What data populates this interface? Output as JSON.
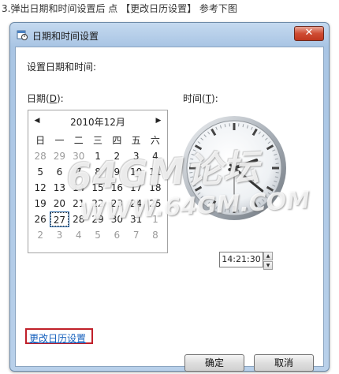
{
  "caption": "3.弹出日期和时间设置后 点 【更改日历设置】 参考下图",
  "window": {
    "title": "日期和时间设置",
    "close_label": "✕"
  },
  "heading": "设置日期和时间:",
  "date_label": {
    "text": "日期(",
    "hotkey": "D",
    "suffix": "):"
  },
  "time_label": {
    "text": "时间(",
    "hotkey": "T",
    "suffix": "):"
  },
  "calendar": {
    "prev_icon": "◀",
    "next_icon": "▶",
    "month_title": "2010年12月",
    "weekdays": [
      "日",
      "一",
      "二",
      "三",
      "四",
      "五",
      "六"
    ],
    "weeks": [
      [
        "28",
        "29",
        "30",
        "1",
        "2",
        "3",
        "4"
      ],
      [
        "5",
        "6",
        "7",
        "8",
        "9",
        "10",
        "11"
      ],
      [
        "12",
        "13",
        "14",
        "15",
        "16",
        "17",
        "18"
      ],
      [
        "19",
        "20",
        "21",
        "22",
        "23",
        "24",
        "25"
      ],
      [
        "26",
        "27",
        "28",
        "29",
        "30",
        "31",
        "1"
      ],
      [
        "2",
        "3",
        "4",
        "5",
        "6",
        "7",
        "8"
      ]
    ],
    "selected": "27"
  },
  "clock": {
    "hour": 14,
    "minute": 21,
    "second": 30
  },
  "time_value": "14:21:30",
  "change_calendar_link": "更改日历设置",
  "buttons": {
    "ok": "确定",
    "cancel": "取消"
  },
  "watermark": {
    "line1": "64GM论坛",
    "line2": "WWW.64GM.COM"
  }
}
